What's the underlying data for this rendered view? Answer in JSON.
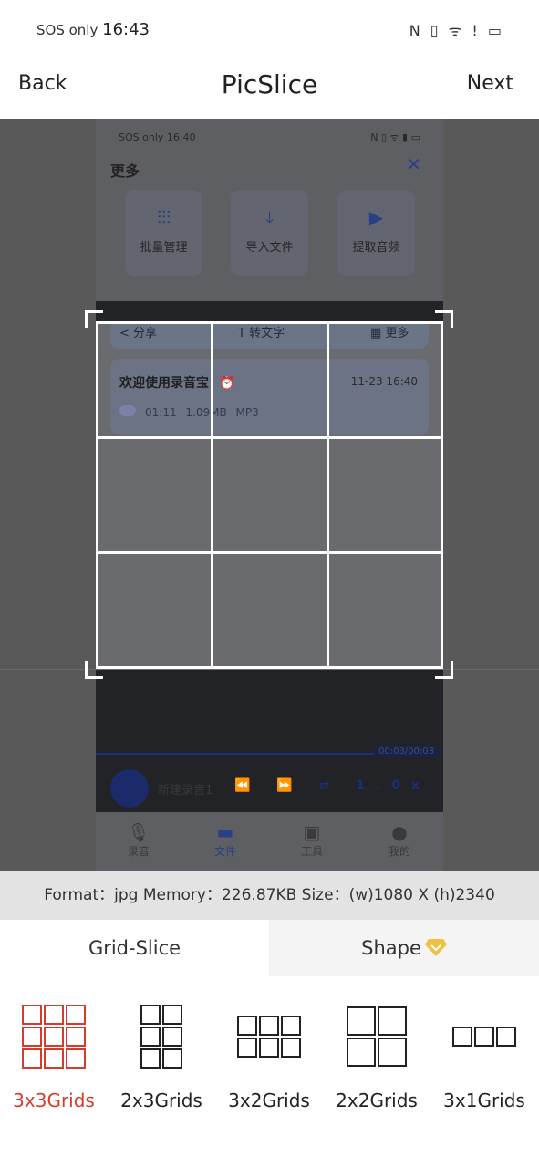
{
  "status_bar": {
    "carrier": "SOS only",
    "time": "16:43",
    "right_icons": "N ▯ ᯤ ! ▭"
  },
  "header": {
    "back": "Back",
    "title": "PicSlice",
    "next": "Next"
  },
  "screenshot": {
    "status": "SOS only 16:40",
    "status_icons": "N ▯ ᯤ ▮ ▭",
    "panel_title": "更多",
    "close": "✕",
    "cards": [
      {
        "icon": "sliders-icon",
        "glyph": "⫶⫶⫶",
        "label": "批量管理"
      },
      {
        "icon": "download-icon",
        "glyph": "⤓",
        "label": "导入文件"
      },
      {
        "icon": "video-icon",
        "glyph": "▶",
        "label": "提取音频"
      }
    ],
    "actions": [
      {
        "glyph": "<",
        "label": "分享"
      },
      {
        "glyph": "T",
        "label": "转文字"
      },
      {
        "glyph": "▦",
        "label": "更多"
      }
    ],
    "record": {
      "title": "欢迎使用录音宝! ⏰",
      "date": "11-23 16:40",
      "meta": "01:11 1.09MB MP3"
    },
    "player": {
      "time": "00:03/00:03",
      "name": "新建录音1",
      "controls": "⏪ ⏩ ⇄ 1.0x"
    },
    "nav": [
      {
        "glyph": "🎙",
        "label": "录音"
      },
      {
        "glyph": "▬",
        "label": "文件",
        "active": true
      },
      {
        "glyph": "▣",
        "label": "工具"
      },
      {
        "glyph": "●",
        "label": "我的"
      }
    ]
  },
  "info": "Format：jpg Memory：226.87KB Size：(w)1080 X (h)2340",
  "tabs": [
    {
      "label": "Grid-Slice",
      "active": true
    },
    {
      "label": "Shape",
      "badge": "diamond-icon"
    }
  ],
  "grid_options": [
    {
      "label": "3x3Grids",
      "cols": 3,
      "rows": 3,
      "selected": true
    },
    {
      "label": "2x3Grids",
      "cols": 2,
      "rows": 3
    },
    {
      "label": "3x2Grids",
      "cols": 3,
      "rows": 2
    },
    {
      "label": "2x2Grids",
      "cols": 2,
      "rows": 2
    },
    {
      "label": "3x1Grids",
      "cols": 3,
      "rows": 1
    }
  ],
  "colors": {
    "accent": "#d43c2c",
    "premium": "#f0c040",
    "crop_line": "#ffffff"
  }
}
